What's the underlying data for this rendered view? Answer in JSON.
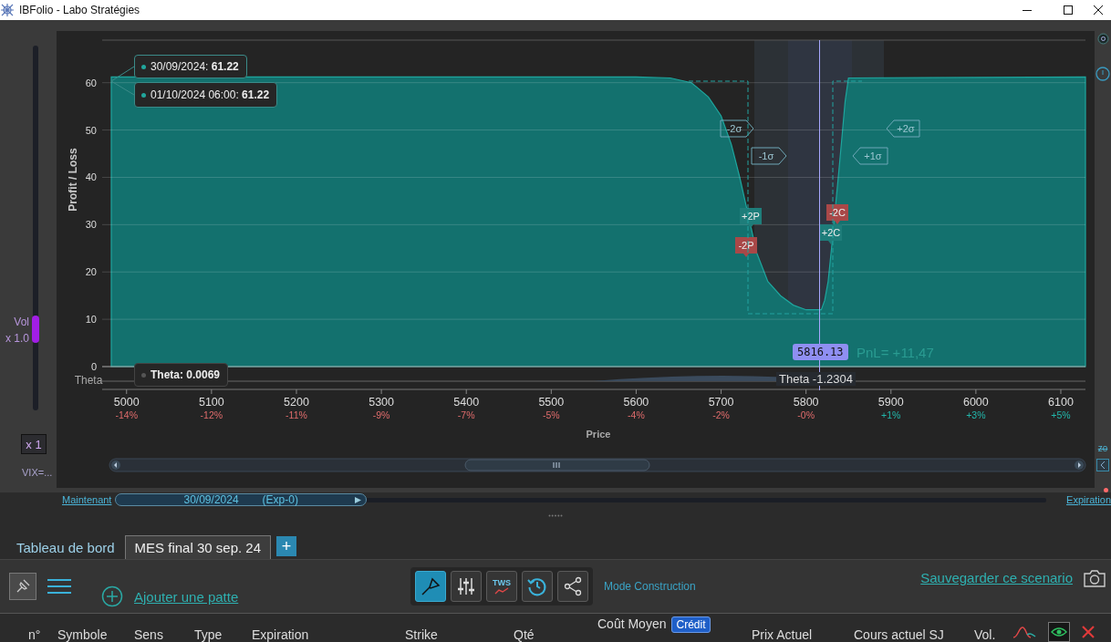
{
  "window": {
    "title": "IBFolio - Labo Stratégies"
  },
  "volatility_slider": {
    "label": "Vol",
    "reading": "x 1.0",
    "level": 0.2
  },
  "multiplier_button": "x 1",
  "vix_label": "VIX=...",
  "chart": {
    "chart_data": {
      "type": "area",
      "xlabel": "Price",
      "ylabel": "Profit / Loss",
      "grid": true,
      "x": [
        4982,
        5600,
        5640,
        5665,
        5685,
        5700,
        5712,
        5722,
        5732,
        5742,
        5755,
        5770,
        5785,
        5800,
        5812,
        5818,
        5822,
        5826,
        5830,
        5834,
        5838,
        5842,
        5846,
        5850,
        6129
      ],
      "series": [
        {
          "color": "#13716e",
          "values": [
            61.22,
            61.22,
            61,
            60,
            57,
            53,
            47,
            40,
            null,
            24,
            18,
            15,
            13,
            12,
            12,
            12,
            14,
            18,
            25,
            null,
            40,
            48,
            56,
            61,
            61.22
          ]
        }
      ],
      "xlim": [
        4982,
        6129
      ],
      "ylim": [
        0,
        69
      ],
      "xticks": [
        5000,
        5100,
        5200,
        5300,
        5400,
        5500,
        5600,
        5700,
        5800,
        5900,
        6000,
        6100
      ],
      "yticks": [
        0,
        10,
        20,
        30,
        40,
        50,
        60
      ]
    },
    "price_change_labels": [
      {
        "text": "-14%",
        "kind": "negative"
      },
      {
        "text": "-12%",
        "kind": "negative"
      },
      {
        "text": "-11%",
        "kind": "negative"
      },
      {
        "text": "-9%",
        "kind": "negative"
      },
      {
        "text": "-7%",
        "kind": "negative"
      },
      {
        "text": "-5%",
        "kind": "negative"
      },
      {
        "text": "-4%",
        "kind": "negative"
      },
      {
        "text": "-2%",
        "kind": "negative"
      },
      {
        "text": "-0%",
        "kind": "negative"
      },
      {
        "text": "+1%",
        "kind": "positive"
      },
      {
        "text": "+3%",
        "kind": "positive"
      },
      {
        "text": "+5%",
        "kind": "positive"
      }
    ],
    "tooltips": [
      {
        "text": "30/09/2024: **61.22**"
      },
      {
        "text": "01/10/2024 06:00: **61.22**"
      }
    ],
    "sigma_tags": [
      {
        "label": "-2σ",
        "kind": "arrow_right"
      },
      {
        "label": "-1σ",
        "kind": "arrow_right"
      },
      {
        "label": "+1σ",
        "kind": "arrow_left"
      },
      {
        "label": "+2σ",
        "kind": "arrow_left"
      }
    ],
    "legs": [
      {
        "label": "+2P",
        "color": "#1e7d7a"
      },
      {
        "label": "-2P",
        "color": "#a94848"
      },
      {
        "label": "-2C",
        "color": "#a94848"
      },
      {
        "label": "+2C",
        "color": "#1e7d7a"
      }
    ],
    "price_marker": "5816.13",
    "pnl": "PnL= +11,47",
    "theta_axis_label": "Theta",
    "theta_reading": "Theta -1.2304",
    "theta_tooltip": "Theta: 0.0069"
  },
  "right_panel": {
    "zoom_label": "zo"
  },
  "timeline": {
    "start_link": "Maintenant",
    "date": "30/09/2024",
    "expiry": "(Exp-0)",
    "level": 0.27,
    "end_link": "Expiration"
  },
  "tabs": [
    {
      "label": "Tableau de bord",
      "selected": false
    },
    {
      "label": "MES final 30 sep. 24",
      "selected": true
    }
  ],
  "add_tab": "+",
  "toolbar": {
    "add_leg": "Ajouter une patte",
    "tools": [
      {
        "kind": "trowel",
        "selected": true
      },
      {
        "kind": "sliders",
        "selected": false
      },
      {
        "kind": "tws",
        "label": "TWS",
        "selected": false
      },
      {
        "kind": "history",
        "selected": false
      },
      {
        "kind": "share",
        "selected": false
      }
    ],
    "mode": "Mode Construction",
    "save_link": "Sauvegarder ce scenario"
  },
  "table": {
    "columns": [
      {
        "label": "n°"
      },
      {
        "label": "Symbole"
      },
      {
        "label": "Sens"
      },
      {
        "label": "Type"
      },
      {
        "label": "Expiration"
      },
      {
        "label": "Strike"
      },
      {
        "label": "Qté"
      },
      {
        "label": "Coût Moyen",
        "badge": "Crédit"
      },
      {
        "label": "Prix Actuel"
      },
      {
        "label": "Cours actuel SJ"
      },
      {
        "label": "Vol."
      }
    ]
  }
}
